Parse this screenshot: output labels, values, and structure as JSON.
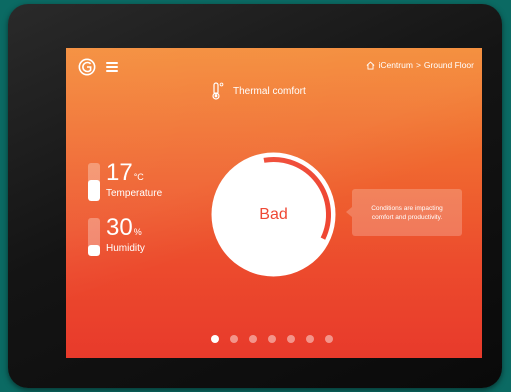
{
  "header": {
    "breadcrumb_home": "iCentrum",
    "breadcrumb_separator": ">",
    "breadcrumb_current": "Ground Floor"
  },
  "title": "Thermal comfort",
  "metrics": {
    "temperature": {
      "value": "17",
      "unit": "°C",
      "label": "Temperature",
      "level": 0.55
    },
    "humidity": {
      "value": "30",
      "unit": "%",
      "label": "Humidity",
      "level": 0.3
    }
  },
  "gauge": {
    "status": "Bad",
    "level": 0.35,
    "color": "#ef4733"
  },
  "tooltip": {
    "text": "Conditions are impacting comfort and productivity."
  },
  "pagination": {
    "total": 7,
    "active": 0
  }
}
